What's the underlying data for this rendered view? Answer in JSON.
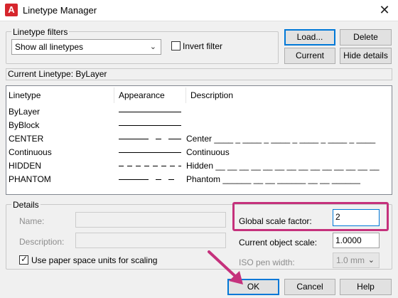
{
  "window": {
    "title": "Linetype Manager",
    "app_icon_letter": "A",
    "close_glyph": "✕"
  },
  "filters": {
    "group_label": "Linetype filters",
    "selected": "Show all linetypes",
    "invert_label": "Invert filter",
    "invert_checked": false
  },
  "buttons": {
    "load": "Load...",
    "delete": "Delete",
    "current": "Current",
    "hide_details": "Hide details",
    "ok": "OK",
    "cancel": "Cancel",
    "help": "Help"
  },
  "current_linetype": "Current Linetype:  ByLayer",
  "table": {
    "headers": [
      "Linetype",
      "Appearance",
      "Description"
    ],
    "rows": [
      {
        "name": "ByLayer",
        "description": ""
      },
      {
        "name": "ByBlock",
        "description": ""
      },
      {
        "name": "CENTER",
        "description": "Center ____ _ ____ _ ____ _ ____ _ ____ _ ____"
      },
      {
        "name": "Continuous",
        "description": "Continuous"
      },
      {
        "name": "HIDDEN",
        "description": "Hidden __ __ __ __ __ __ __ __ __ __ __ __ __ __"
      },
      {
        "name": "PHANTOM",
        "description": "Phantom ______ __ __ ______ __ __ ______"
      }
    ]
  },
  "details": {
    "group_label": "Details",
    "name_label": "Name:",
    "description_label": "Description:",
    "paper_space_label": "Use paper space units for scaling",
    "paper_space_checked": true,
    "global_scale_label": "Global scale factor:",
    "global_scale_value": "2",
    "object_scale_label": "Current object scale:",
    "object_scale_value": "1.0000",
    "iso_pen_label": "ISO pen width:",
    "iso_pen_value": "1.0 mm"
  },
  "colors": {
    "annotation": "#c5317c",
    "focus": "#0078d7"
  }
}
